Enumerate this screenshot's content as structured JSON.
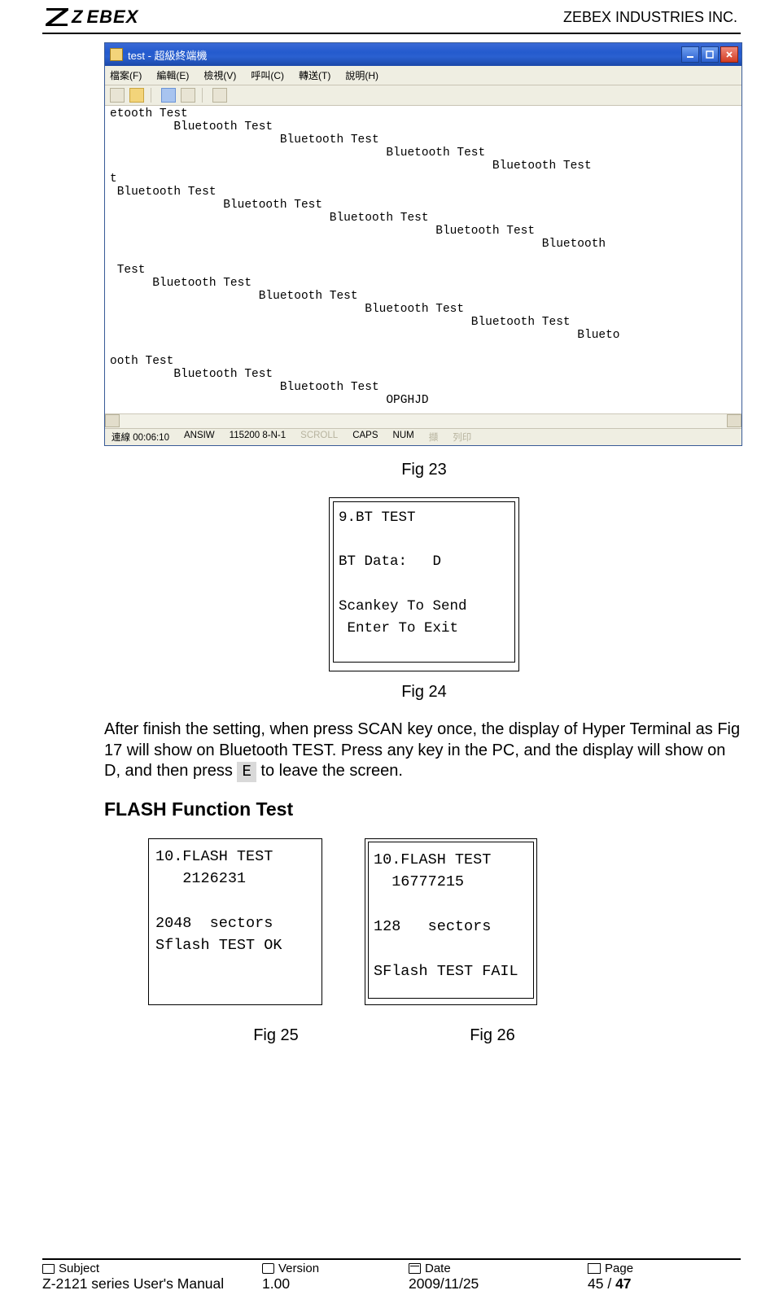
{
  "header": {
    "brand_left": "Z",
    "brand_right": "EBEX",
    "company": "ZEBEX INDUSTRIES INC."
  },
  "fig23": {
    "title": "test - 超級終端機",
    "menus": [
      "檔案(F)",
      "編輯(E)",
      "檢視(V)",
      "呼叫(C)",
      "轉送(T)",
      "說明(H)"
    ],
    "body": "etooth Test\n         Bluetooth Test\n                        Bluetooth Test\n                                       Bluetooth Test\n                                                      Bluetooth Test\nt\n Bluetooth Test\n                Bluetooth Test\n                               Bluetooth Test\n                                              Bluetooth Test\n                                                             Bluetooth\n\n Test\n      Bluetooth Test\n                     Bluetooth Test\n                                    Bluetooth Test\n                                                   Bluetooth Test\n                                                                  Blueto\n\nooth Test\n         Bluetooth Test\n                        Bluetooth Test\n                                       OPGHJD",
    "status": [
      "連線 00:06:10",
      "ANSIW",
      "115200 8-N-1",
      "SCROLL",
      "CAPS",
      "NUM",
      "擷",
      "列印"
    ],
    "caption": "Fig 23"
  },
  "fig24": {
    "lines": "9.BT TEST\n\nBT Data:   D\n\nScankey To Send\n Enter To Exit",
    "caption": "Fig 24"
  },
  "paragraph": {
    "t1": "After finish the setting, when press SCAN key once, the display of Hyper Terminal as Fig 17 will show on Bluetooth TEST. Press any key in the PC, and the display will show on D, and then press ",
    "key": "E",
    "t2": " to leave the screen."
  },
  "section": "FLASH Function Test",
  "fig25": {
    "lines": "10.FLASH TEST\n   2126231\n\n2048  sectors\nSflash TEST OK",
    "caption": "Fig  25"
  },
  "fig26": {
    "lines": "10.FLASH TEST\n  16777215\n\n128   sectors\n\nSFlash TEST FAIL",
    "caption": "Fig  26"
  },
  "footer": {
    "labels": {
      "subject": "Subject",
      "version": "Version",
      "date": "Date",
      "page": "Page"
    },
    "values": {
      "subject": "Z-2121 series User's Manual",
      "version": "1.00",
      "date": "2009/11/25"
    },
    "page_cur": "45",
    "page_sep": " / ",
    "page_total": "47"
  }
}
